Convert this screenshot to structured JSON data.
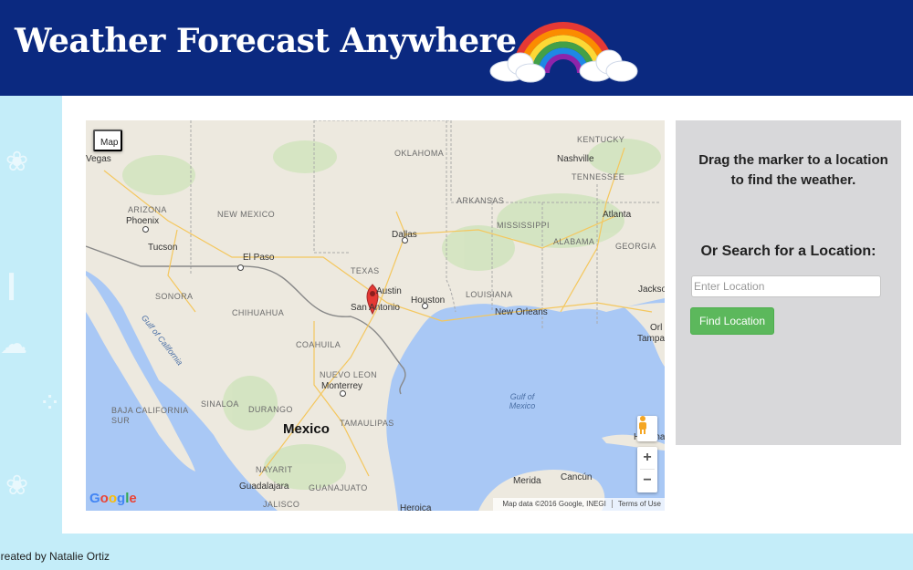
{
  "header": {
    "title": "Weather Forecast Anywhere"
  },
  "map": {
    "type_button": "Map",
    "attribution": "Map data ©2016 Google, INEGI",
    "terms": "Terms of Use",
    "logo": "Google",
    "zoom_in": "+",
    "zoom_out": "−",
    "labels": {
      "country": "Mexico",
      "states": [
        "KENTUCKY",
        "OKLAHOMA",
        "TENNESSEE",
        "ARKANSAS",
        "ARIZONA",
        "NEW MEXICO",
        "MISSISSIPPI",
        "ALABAMA",
        "GEORGIA",
        "TEXAS",
        "LOUISIANA",
        "SONORA",
        "CHIHUAHUA",
        "COAHUILA",
        "NUEVO LEON",
        "SINALOA",
        "DURANGO",
        "TAMAULIPAS",
        "BAJA CALIFORNIA SUR",
        "NAYARIT",
        "JALISCO",
        "GUANAJUATO"
      ],
      "cities": [
        "Vegas",
        "Nashville",
        "Phoenix",
        "Atlanta",
        "Tucson",
        "Dallas",
        "El Paso",
        "Austin",
        "Houston",
        "Jackso",
        "San Antonio",
        "New Orleans",
        "Orl",
        "Tampa",
        "Monterrey",
        "Merida",
        "Cancún",
        "Havana",
        "Guadalajara",
        "Heroica"
      ],
      "water": [
        "Gulf of California",
        "Gulf of Mexico"
      ]
    }
  },
  "panel": {
    "instruction_line1": "Drag the marker to a location",
    "instruction_line2": "to find the weather.",
    "search_title": "Or Search for a Location:",
    "input_placeholder": "Enter Location",
    "input_value": "",
    "button_label": "Find Location",
    "button_color": "#5cb85c"
  },
  "footer": {
    "credit": "Created by Natalie Ortiz"
  },
  "colors": {
    "header_bg": "#0b2980",
    "page_bg": "#c4edf9",
    "panel_bg": "#d8d8da",
    "water": "#a9c8f5",
    "land": "#ede9df",
    "marker": "#e53935"
  }
}
